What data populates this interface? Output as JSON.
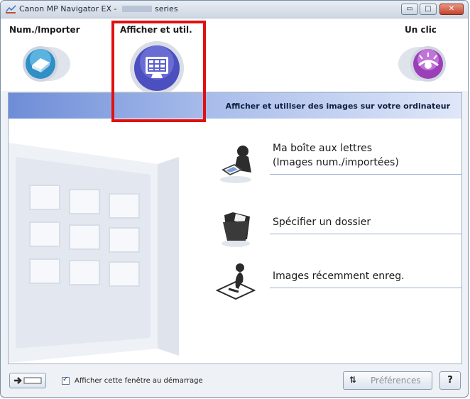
{
  "window": {
    "title_prefix": "Canon MP Navigator EX - ",
    "title_suffix": "series",
    "min_glyph": "▭",
    "max_glyph": "□",
    "close_glyph": "✕"
  },
  "modes": {
    "scan": {
      "label": "Num./Importer",
      "icon": "scanner-icon"
    },
    "view": {
      "label": "Afficher et util.",
      "icon": "monitor-grid-icon"
    },
    "oneclick": {
      "label": "Un clic",
      "icon": "one-click-icon"
    }
  },
  "panel": {
    "title": "Afficher et utiliser des images sur votre ordinateur",
    "entries": [
      {
        "label": "Ma boîte aux lettres\n(Images num./importées)",
        "icon": "mailbox-person-icon"
      },
      {
        "label": "Spécifier un dossier",
        "icon": "folder-icon"
      },
      {
        "label": "Images récemment enreg.",
        "icon": "recent-images-icon"
      }
    ]
  },
  "footer": {
    "checkbox_label": "Afficher cette fenêtre au démarrage",
    "checkbox_checked": true,
    "checkbox_glyph": "✓",
    "preferences_label": "Préférences",
    "preferences_icon": "⇅",
    "help_label": "?"
  },
  "colors": {
    "highlight": "#e01010",
    "panel_header": "#6e8dd7"
  }
}
